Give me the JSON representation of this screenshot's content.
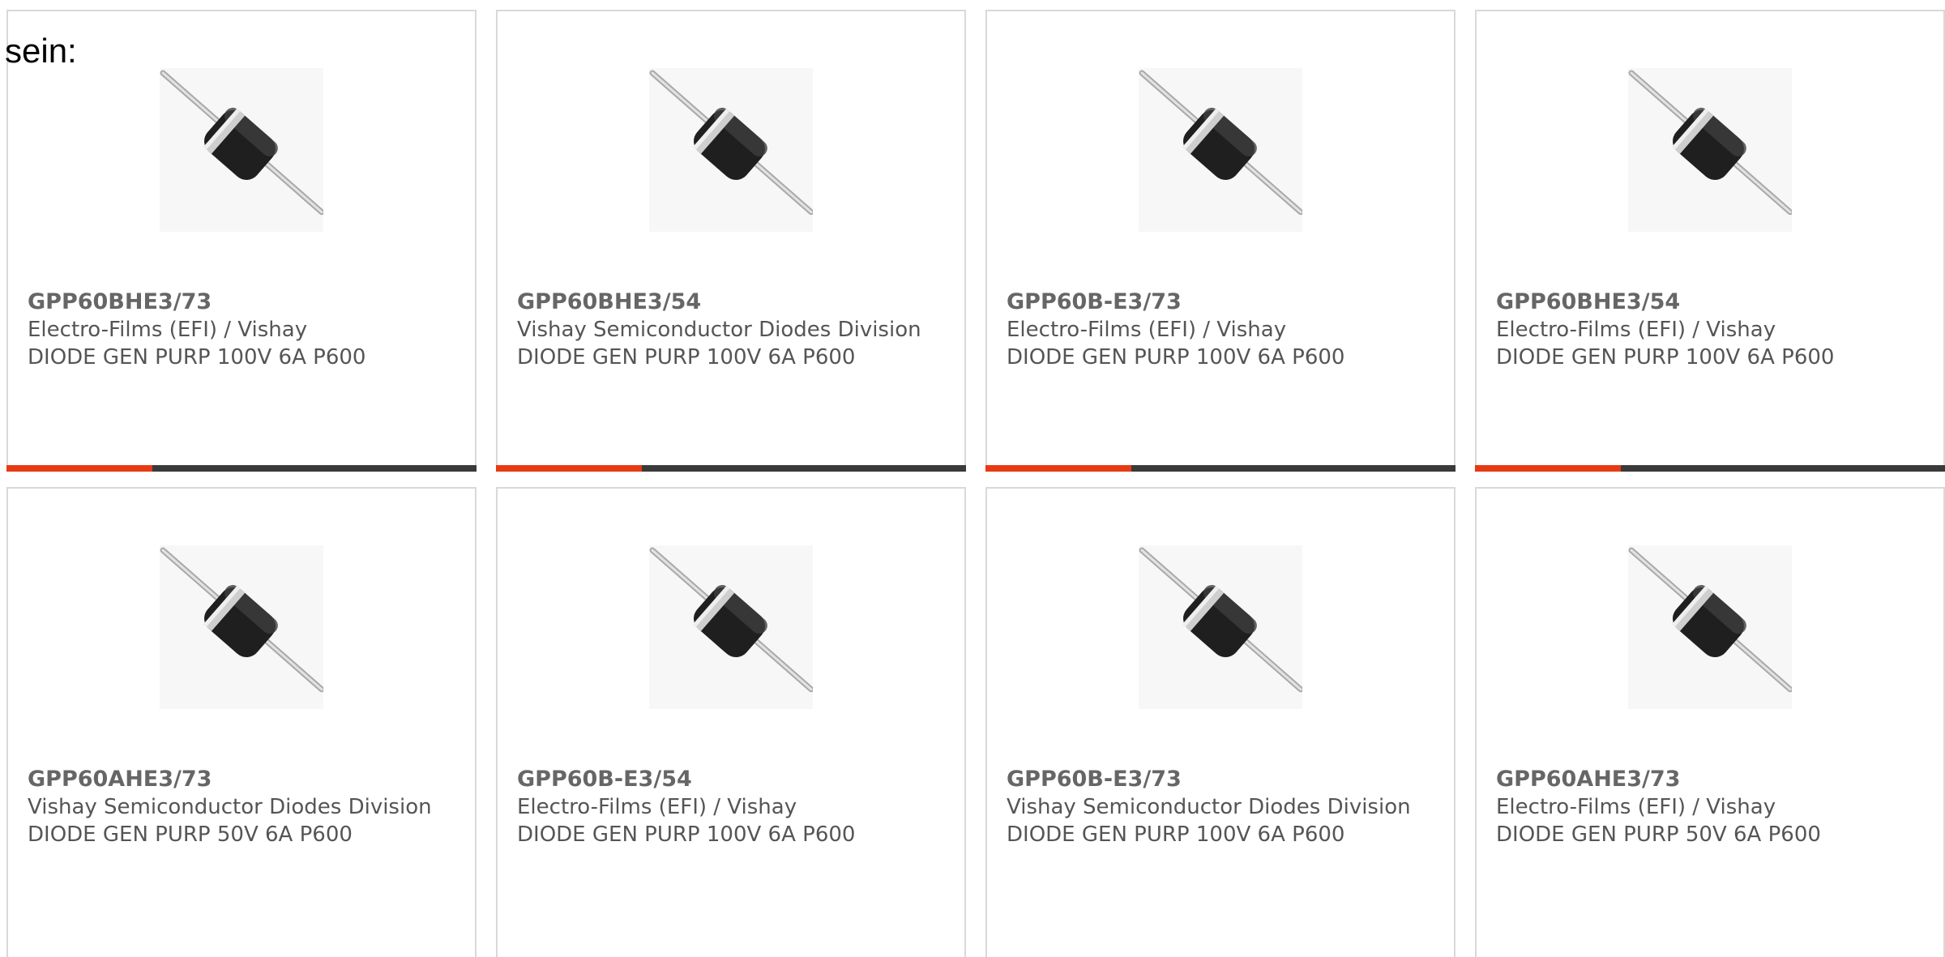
{
  "prefix_text": "sein:",
  "theme": {
    "accent_color": "#e63a14",
    "bar_color": "#3a3a3a",
    "card_border_color": "#d9d9d9",
    "text_color": "#555555"
  },
  "products": [
    {
      "part_number": "GPP60BHE3/73",
      "manufacturer": "Electro-Films (EFI) / Vishay",
      "description": "DIODE GEN PURP 100V 6A P600",
      "image": "axial-diode-image",
      "bar_progress": 0.31
    },
    {
      "part_number": "GPP60BHE3/54",
      "manufacturer": "Vishay Semiconductor Diodes Division",
      "description": "DIODE GEN PURP 100V 6A P600",
      "image": "axial-diode-image",
      "bar_progress": 0.31
    },
    {
      "part_number": "GPP60B-E3/73",
      "manufacturer": "Electro-Films (EFI) / Vishay",
      "description": "DIODE GEN PURP 100V 6A P600",
      "image": "axial-diode-image",
      "bar_progress": 0.31
    },
    {
      "part_number": "GPP60BHE3/54",
      "manufacturer": "Electro-Films (EFI) / Vishay",
      "description": "DIODE GEN PURP 100V 6A P600",
      "image": "axial-diode-image",
      "bar_progress": 0.31
    },
    {
      "part_number": "GPP60AHE3/73",
      "manufacturer": "Vishay Semiconductor Diodes Division",
      "description": "DIODE GEN PURP 50V 6A P600",
      "image": "axial-diode-image",
      "bar_progress": null
    },
    {
      "part_number": "GPP60B-E3/54",
      "manufacturer": "Electro-Films (EFI) / Vishay",
      "description": "DIODE GEN PURP 100V 6A P600",
      "image": "axial-diode-image",
      "bar_progress": null
    },
    {
      "part_number": "GPP60B-E3/73",
      "manufacturer": "Vishay Semiconductor Diodes Division",
      "description": "DIODE GEN PURP 100V 6A P600",
      "image": "axial-diode-image",
      "bar_progress": null
    },
    {
      "part_number": "GPP60AHE3/73",
      "manufacturer": "Electro-Films (EFI) / Vishay",
      "description": "DIODE GEN PURP 50V 6A P600",
      "image": "axial-diode-image",
      "bar_progress": null
    }
  ]
}
